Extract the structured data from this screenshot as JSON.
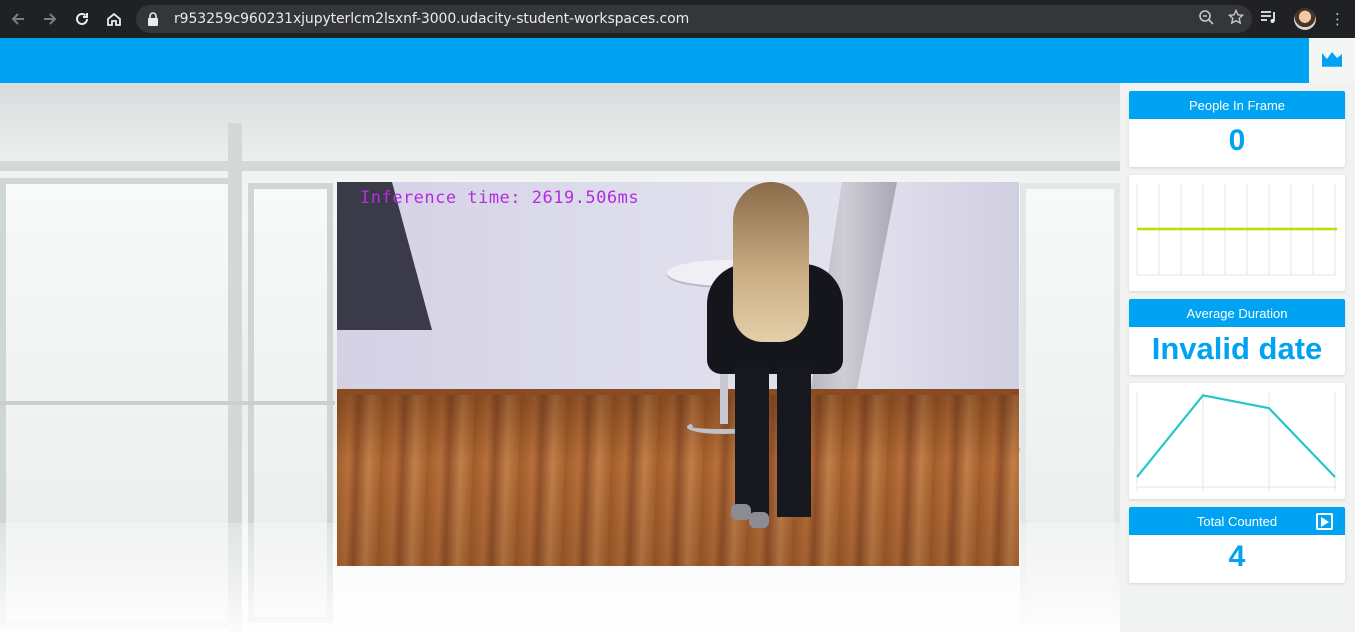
{
  "browser": {
    "url": "r953259c960231xjupyterlcm2lsxnf-3000.udacity-student-workspaces.com"
  },
  "video": {
    "inference_text": "Inference time: 2619.506ms"
  },
  "stats": {
    "people_in_frame": {
      "label": "People In Frame",
      "value": "0"
    },
    "average_duration": {
      "label": "Average Duration",
      "value": "Invalid date"
    },
    "total_counted": {
      "label": "Total Counted",
      "value": "4"
    }
  },
  "colors": {
    "accent": "#00a3f2",
    "people_line": "#b4e000",
    "duration_line": "#26c6c6",
    "inference_text": "#b42ce0"
  },
  "icons": [
    "back-icon",
    "forward-icon",
    "reload-icon",
    "home-icon",
    "lock-icon",
    "zoom-icon",
    "star-icon",
    "media-icon",
    "avatar",
    "menu-icon",
    "area-chart-icon",
    "play-icon"
  ],
  "chart_data": [
    {
      "type": "line",
      "series": [
        {
          "values": [
            0,
            0,
            0,
            0,
            0,
            0,
            0,
            0,
            0,
            0
          ]
        }
      ],
      "grid": true
    },
    {
      "type": "line",
      "series": [
        {
          "values": [
            0,
            0.95,
            0.8,
            0
          ]
        }
      ],
      "grid": true
    }
  ]
}
